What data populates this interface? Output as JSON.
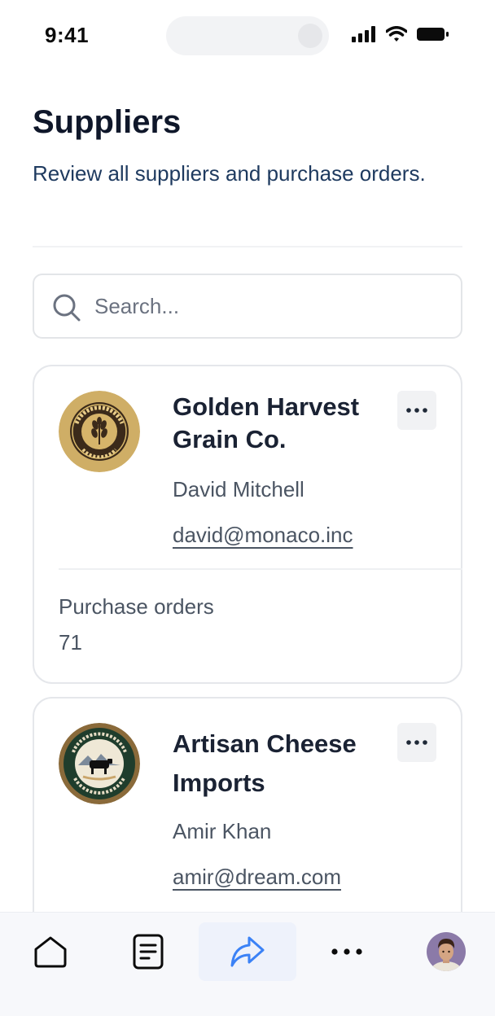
{
  "status_bar": {
    "time": "9:41"
  },
  "header": {
    "title": "Suppliers",
    "subtitle": "Review all suppliers and purchase orders."
  },
  "search": {
    "placeholder": "Search..."
  },
  "suppliers": [
    {
      "name": "Golden Harvest Grain Co.",
      "contact": "David Mitchell",
      "email": "david@monaco.inc",
      "orders_label": "Purchase orders",
      "orders_count": "71",
      "logo_text": "GOLDEN HARVEST Co. GRAIN CO"
    },
    {
      "name": "Artisan Cheese Imports",
      "contact": "Amir Khan",
      "email": "amir@dream.com",
      "logo_text": "HERITAGE VALLEY ARTISAN CHEESE CO."
    }
  ],
  "bottom_nav": {
    "items": [
      "home-icon",
      "document-icon",
      "share-icon",
      "more-icon",
      "avatar"
    ],
    "active": "share-icon"
  },
  "colors": {
    "title": "#0f172a",
    "subtitle": "#1e3a5f",
    "active_nav": "#3b82f6"
  }
}
